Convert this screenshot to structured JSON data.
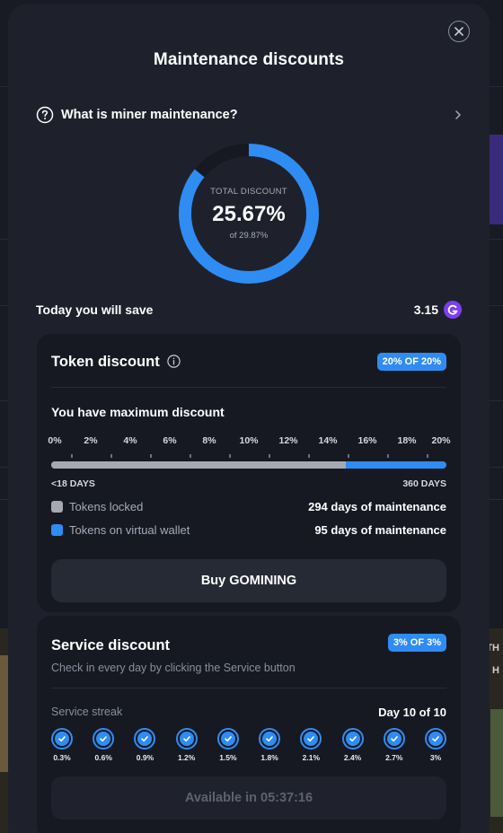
{
  "modal": {
    "title": "Maintenance discounts",
    "info_link": "What is miner maintenance?"
  },
  "total": {
    "caption": "TOTAL DISCOUNT",
    "value": "25.67%",
    "of": "of 29.87%",
    "fraction": 0.859
  },
  "save": {
    "label": "Today you will save",
    "value": "3.15"
  },
  "token": {
    "title": "Token discount",
    "badge": "20% OF 20%",
    "status": "You have maximum discount",
    "ticks": [
      "0%",
      "2%",
      "4%",
      "6%",
      "8%",
      "10%",
      "12%",
      "14%",
      "16%",
      "18%",
      "20%"
    ],
    "bar_locked_fraction": 0.745,
    "min_label": "<18 DAYS",
    "max_label": "360 DAYS",
    "legend": [
      {
        "label": "Tokens locked",
        "value": "294 days of maintenance",
        "color": "#a6a9b3"
      },
      {
        "label": "Tokens on virtual wallet",
        "value": "95 days of maintenance",
        "color": "#2f8cf3"
      }
    ],
    "button": "Buy GOMINING"
  },
  "service": {
    "title": "Service discount",
    "badge": "3% OF 3%",
    "subtitle": "Check in every day by clicking the Service button",
    "streak_label": "Service streak",
    "streak_value": "Day 10 of 10",
    "days": [
      "0.3%",
      "0.6%",
      "0.9%",
      "1.2%",
      "1.5%",
      "1.8%",
      "2.1%",
      "2.4%",
      "2.7%",
      "3%"
    ],
    "button": "Available in 05:37:16"
  },
  "backdrop": {
    "tag1": "TH",
    "tag2": "H"
  },
  "colors": {
    "accent": "#2f8cf3",
    "coin": "#7b3ff2"
  }
}
